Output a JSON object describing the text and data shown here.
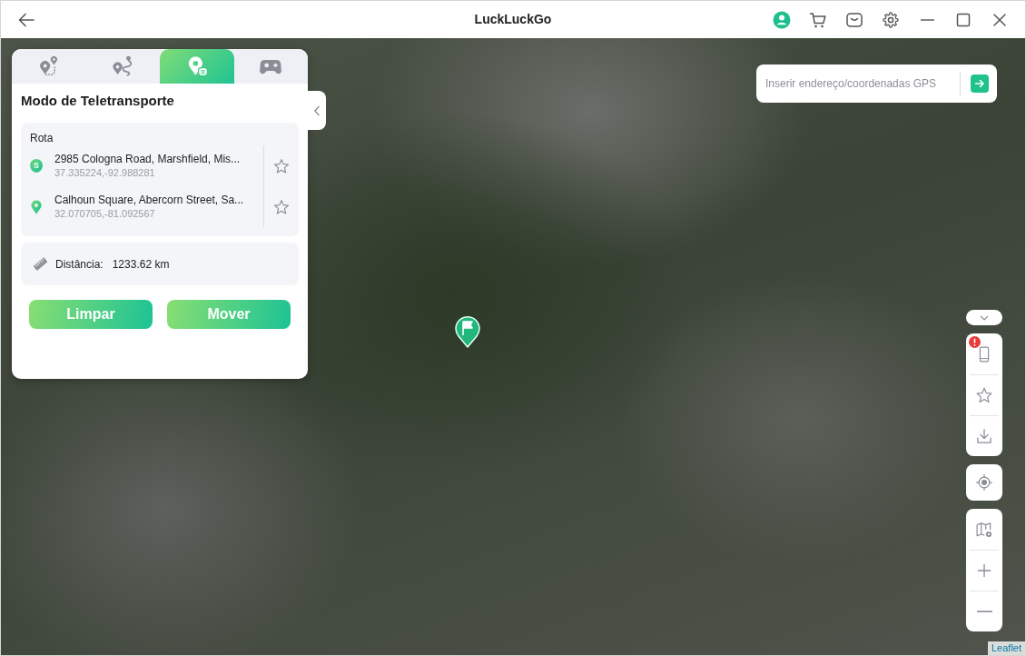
{
  "window": {
    "title": "LuckLuckGo"
  },
  "panel": {
    "tabs": [
      {
        "kind": "ab-route",
        "selected": false
      },
      {
        "kind": "multi-stop",
        "selected": false
      },
      {
        "kind": "teleport",
        "selected": true
      },
      {
        "kind": "joystick",
        "selected": false
      }
    ],
    "title": "Modo de Teletransporte",
    "route": {
      "label": "Rota",
      "stops": [
        {
          "kind": "start",
          "badge": "S",
          "address": "2985 Cologna Road, Marshfield, Mis...",
          "coords": "37.335224,-92.988281"
        },
        {
          "kind": "destination",
          "address": "Calhoun Square, Abercorn Street, Sa...",
          "coords": "32.070705,-81.092567"
        }
      ]
    },
    "distance": {
      "label": "Distância:",
      "value": "1233.62 km"
    },
    "buttons": [
      "Limpar",
      "Mover"
    ]
  },
  "search": {
    "placeholder": "Inserir endereço/coordenadas GPS"
  },
  "map_tools": [
    {
      "tools": [
        {
          "kind": "device",
          "alert": true
        },
        {
          "kind": "favorites",
          "alert": false
        },
        {
          "kind": "import",
          "alert": false
        }
      ]
    },
    {
      "tools": [
        {
          "kind": "locate",
          "alert": false
        }
      ]
    },
    {
      "tools": [
        {
          "kind": "layers",
          "alert": false
        },
        {
          "kind": "zoom-in",
          "alert": false
        },
        {
          "kind": "zoom-out",
          "alert": false
        }
      ]
    }
  ],
  "attribution": "Leaflet"
}
